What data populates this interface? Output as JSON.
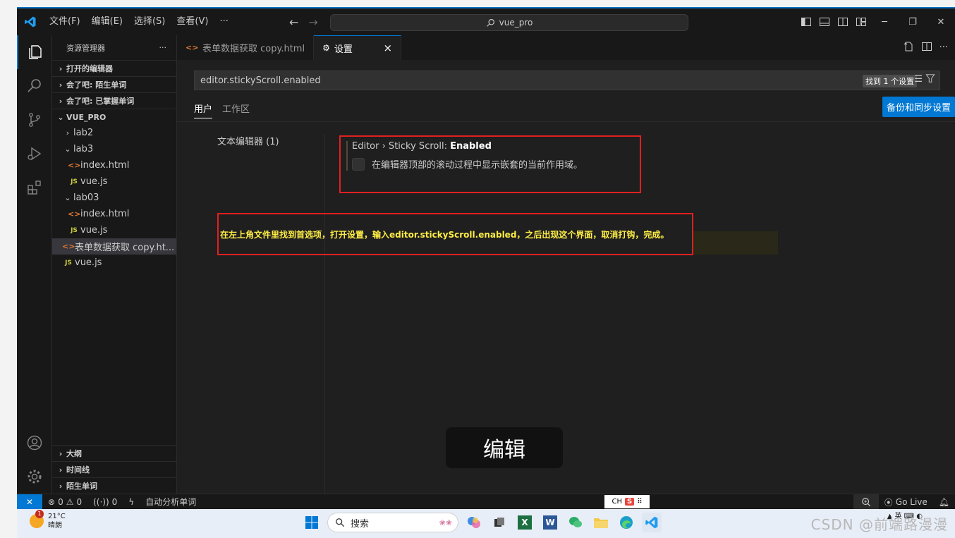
{
  "titlebar": {
    "menus": [
      "文件(F)",
      "编辑(E)",
      "选择(S)",
      "查看(V)",
      "···"
    ],
    "search_text": "vue_pro"
  },
  "sidebar": {
    "title": "资源管理器",
    "more": "···",
    "sections_top": [
      "打开的编辑器",
      "会了吧: 陌生单词",
      "会了吧: 已掌握单词"
    ],
    "project": "VUE_PRO",
    "tree": [
      {
        "label": "lab2",
        "type": "folder-closed"
      },
      {
        "label": "lab3",
        "type": "folder-open"
      },
      {
        "label": "index.html",
        "type": "html"
      },
      {
        "label": "vue.js",
        "type": "js"
      },
      {
        "label": "lab03",
        "type": "folder-open"
      },
      {
        "label": "index.html",
        "type": "html"
      },
      {
        "label": "vue.js",
        "type": "js"
      },
      {
        "label": "表单数据获取 copy.ht...",
        "type": "html"
      },
      {
        "label": "vue.js",
        "type": "js"
      }
    ],
    "sections_bottom": [
      "大纲",
      "时间线",
      "陌生单词"
    ]
  },
  "tabs": [
    {
      "label": "表单数据获取 copy.html"
    },
    {
      "label": "设置",
      "close": "×"
    }
  ],
  "settings": {
    "query": "editor.stickyScroll.enabled",
    "found": "找到 1 个设置",
    "scope_tabs": [
      "用户",
      "工作区"
    ],
    "sync_button": "备份和同步设置",
    "toc_item": "文本编辑器 (1)",
    "item_prefix": "Editor › Sticky Scroll: ",
    "item_name": "Enabled",
    "item_desc": "在编辑器顶部的滚动过程中显示嵌套的当前作用域。",
    "checked": false
  },
  "annotation": "在左上角文件里找到首选项，打开设置，输入editor.stickyScroll.enabled，之后出现这个界面，取消打钩，完成。",
  "overlay_label": "编辑",
  "statusbar": {
    "errors": "0",
    "warnings": "0",
    "ports": "0",
    "extension_text": "自动分析单词",
    "ime_text": "CH",
    "go_live": "Go Live"
  },
  "taskbar": {
    "temperature": "21°C",
    "weather": "晴朗",
    "weather_badge": "1",
    "search_label": "搜索",
    "watermark": "CSDN @前端路漫漫"
  },
  "colors": {
    "accent": "#0078d4",
    "annotation_box": "#e02020",
    "annotation_text": "#ffee44"
  }
}
